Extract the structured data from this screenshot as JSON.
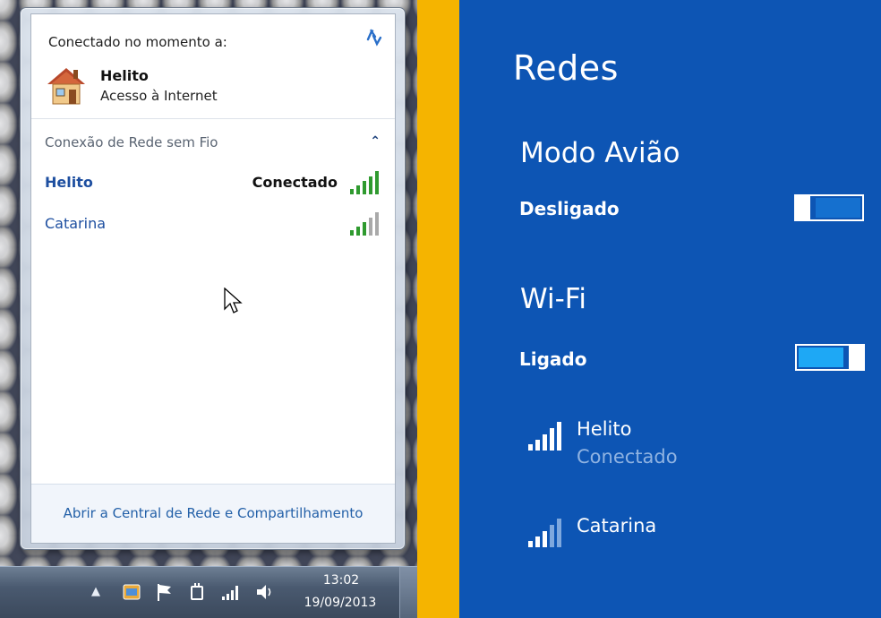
{
  "win7": {
    "connected_title": "Conectado no momento a:",
    "current_network": {
      "name": "Helito",
      "status": "Acesso à Internet"
    },
    "wifi_section_label": "Conexão de Rede sem Fio",
    "networks": [
      {
        "name": "Helito",
        "state": "Conectado",
        "signal_bars": 5
      },
      {
        "name": "Catarina",
        "state": "",
        "signal_bars": 3
      }
    ],
    "footer_link": "Abrir a Central de Rede e Compartilhamento",
    "taskbar": {
      "time": "13:02",
      "date": "19/09/2013"
    }
  },
  "win8": {
    "title": "Redes",
    "airplane": {
      "label": "Modo Avião",
      "state": "Desligado",
      "on": false
    },
    "wifi": {
      "label": "Wi-Fi",
      "state": "Ligado",
      "on": true
    },
    "networks": [
      {
        "name": "Helito",
        "status": "Conectado",
        "signal_bars": 5
      },
      {
        "name": "Catarina",
        "status": "",
        "signal_bars": 3
      }
    ]
  },
  "colors": {
    "win8_bg": "#0d55b4",
    "accent_strip": "#f5b400",
    "win7_link": "#1e4fa0",
    "signal_green": "#2f9a2f"
  }
}
